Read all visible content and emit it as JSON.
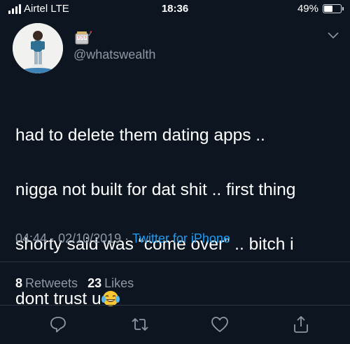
{
  "status_bar": {
    "carrier": "Airtel LTE",
    "time": "18:36",
    "battery": "49%",
    "battery_level": 0.49
  },
  "tweet": {
    "handle": "@whatswealth",
    "text_lines": [
      "had to delete them dating apps ..",
      "nigga not built for dat shit .. first thing",
      "shorty said was “come over” .. bitch i",
      "dont trust u"
    ],
    "time": "04:44",
    "date": "02/10/2019",
    "source": "Twitter for iPhone",
    "retweets_count": "8",
    "retweets_label": "Retweets",
    "likes_count": "23",
    "likes_label": "Likes"
  },
  "icons": {
    "name_emoji": "slot-machine-icon",
    "text_emoji": "tears-of-joy-icon",
    "reply": "reply-icon",
    "retweet": "retweet-icon",
    "like": "heart-icon",
    "share": "share-icon",
    "more": "chevron-down-icon"
  },
  "colors": {
    "background": "#0d1520",
    "secondary_text": "#8b98a5",
    "link": "#1d9bf0"
  }
}
